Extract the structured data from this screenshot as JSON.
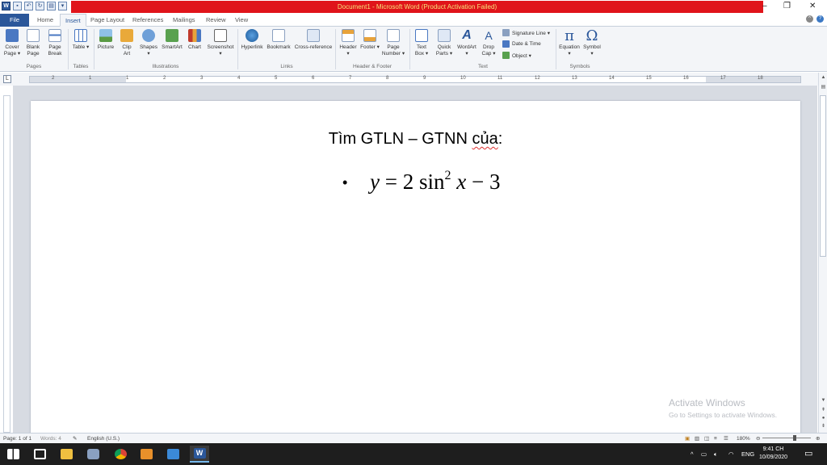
{
  "window": {
    "title": "Document1 - Microsoft Word (Product Activation Failed)"
  },
  "tabs": [
    "File",
    "Home",
    "Insert",
    "Page Layout",
    "References",
    "Mailings",
    "Review",
    "View"
  ],
  "ribbon": {
    "pages": {
      "cover_page": "Cover Page ▾",
      "blank_page": "Blank Page",
      "page_break": "Page Break",
      "label": "Pages"
    },
    "tables": {
      "table": "Table ▾",
      "label": "Tables"
    },
    "illustrations": {
      "picture": "Picture",
      "clip_art": "Clip Art",
      "shapes": "Shapes ▾",
      "smartart": "SmartArt",
      "chart": "Chart",
      "screenshot": "Screenshot ▾",
      "label": "Illustrations"
    },
    "links": {
      "hyperlink": "Hyperlink",
      "bookmark": "Bookmark",
      "cross_reference": "Cross-reference",
      "label": "Links"
    },
    "header_footer": {
      "header": "Header ▾",
      "footer": "Footer ▾",
      "page_number": "Page Number ▾",
      "label": "Header & Footer"
    },
    "text": {
      "text_box": "Text Box ▾",
      "quick_parts": "Quick Parts ▾",
      "wordart": "WordArt ▾",
      "drop_cap": "Drop Cap ▾",
      "signature_line": "Signature Line ▾",
      "date_time": "Date & Time",
      "object": "Object ▾",
      "label": "Text"
    },
    "symbols": {
      "equation": "Equation ▾",
      "symbol": "Symbol ▾",
      "label": "Symbols"
    }
  },
  "ruler": {
    "box": "L",
    "numbers": [
      "2",
      "1",
      "1",
      "2",
      "3",
      "4",
      "5",
      "6",
      "7",
      "8",
      "9",
      "10",
      "11",
      "12",
      "13",
      "14",
      "15",
      "16",
      "17",
      "18"
    ]
  },
  "document": {
    "heading_prefix": "Tìm GTLN – GTNN ",
    "heading_wavy": "của",
    "heading_suffix": ":",
    "bullet": "•",
    "equation": {
      "y": "y",
      "eq": " = 2 sin",
      "sup": "2",
      "x": " x",
      "tail": " − 3"
    }
  },
  "watermark": {
    "line1": "Activate Windows",
    "line2": "Go to Settings to activate Windows."
  },
  "statusbar": {
    "page": "Page: 1 of 1",
    "words": "Words: 4",
    "language": "English (U.S.)",
    "zoom": "180%"
  },
  "taskbar": {
    "tray_lang": "ENG",
    "time": "9:41 CH",
    "date": "10/09/2020"
  },
  "icons": [
    "windows-icon",
    "task-view-icon",
    "file-explorer-icon",
    "camera-icon",
    "chrome-icon",
    "media-player-icon",
    "mail-icon",
    "word-icon"
  ]
}
